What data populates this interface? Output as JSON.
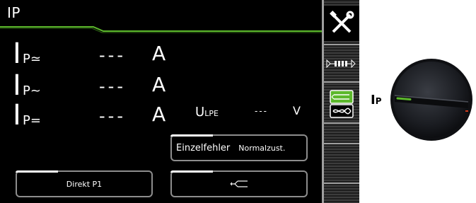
{
  "screen": {
    "title": "IP",
    "colors": {
      "accent": "#5cb82c",
      "background": "#000000",
      "text": "#ffffff"
    }
  },
  "measurements": [
    {
      "symbol": "I",
      "subscript": "P≃",
      "value": "---",
      "unit": "A"
    },
    {
      "symbol": "I",
      "subscript": "P~",
      "value": "---",
      "unit": "A"
    },
    {
      "symbol": "I",
      "subscript": "P=",
      "value": "---",
      "unit": "A"
    }
  ],
  "ulpe": {
    "symbol": "U",
    "subscript": "LPE",
    "value": "---",
    "unit": "V"
  },
  "buttons": {
    "fault_label": "Einzelfehler",
    "fault_state": "Normalzust.",
    "direkt": "Direkt P1"
  },
  "sidebar": {
    "tools_icon": "tools-icon",
    "fuse_icon": "fuse-icon",
    "fuse_label": "▷┠█┨▷",
    "mode_icon": "probe-mode-icon"
  },
  "knob": {
    "label_main": "I",
    "label_sub": "P",
    "indicator_color": "#5cb82c",
    "knob_color": "#17191e"
  }
}
